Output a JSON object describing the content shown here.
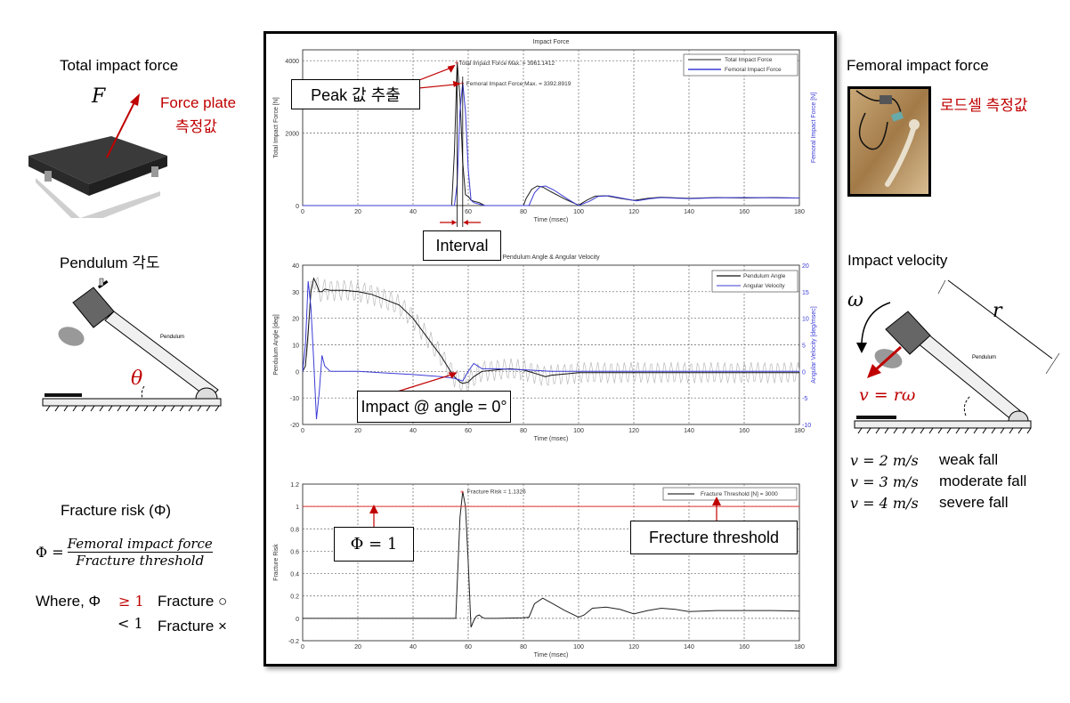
{
  "left_panel": {
    "total_impact_title": "Total impact force",
    "force_symbol": "F",
    "force_plate_label_1": "Force plate",
    "force_plate_label_2": "측정값",
    "pendulum_title": "Pendulum 각도",
    "theta_symbol": "θ",
    "pendulum_text": "Pendulum",
    "fracture_risk_title": "Fracture risk (Φ)",
    "formula_lhs": "Φ =",
    "formula_numerator": "Femoral impact force",
    "formula_denominator": "Fracture threshold",
    "where_label": "Where, Φ",
    "cond_ge": "≥ 1",
    "cond_ge_result": "Fracture ○",
    "cond_lt": "< 1",
    "cond_lt_result": "Fracture ×"
  },
  "right_panel": {
    "femoral_title": "Femoral impact force",
    "loadcell_label": "로드셀 측정값",
    "impact_velocity_title": "Impact velocity",
    "omega_symbol": "ω",
    "r_symbol": "r",
    "v_formula": "v = rω",
    "pendulum_text": "Pendulum",
    "speeds": [
      {
        "formula": "v = 2 m/s",
        "label": "weak fall"
      },
      {
        "formula": "v = 3 m/s",
        "label": "moderate fall"
      },
      {
        "formula": "v = 4 m/s",
        "label": "severe fall"
      }
    ]
  },
  "callouts": {
    "peak": "Peak 값 추출",
    "interval": "Interval",
    "impact_angle": "Impact @ angle = 0°",
    "phi_one": "Φ  = 1",
    "fracture_threshold": "Frecture threshold"
  },
  "colors": {
    "total": "#202020",
    "femoral": "#3b3bd6",
    "threshold": "#e03030",
    "annotation": "#c00000"
  },
  "chart_data": [
    {
      "type": "line",
      "title": "Impact Force",
      "xlabel": "Time (msec)",
      "ylabel": "Total Impact Force [N]",
      "ylabel_right": "Femoral Impact Force [N]",
      "xlim": [
        0,
        180
      ],
      "ylim": [
        0,
        4300
      ],
      "xticks": [
        0,
        20,
        40,
        60,
        80,
        100,
        120,
        140,
        160,
        180
      ],
      "yticks": [
        0,
        2000,
        4000
      ],
      "grid": true,
      "legend": "top-right",
      "annotations": [
        "Total Impact Force Max. = 3961.1412",
        "Femoral Impact Force Max. = 3392.8919"
      ],
      "series": [
        {
          "name": "Total Impact Force",
          "x": [
            0,
            54,
            55,
            56,
            57,
            58,
            59,
            60,
            61,
            62,
            64,
            66,
            80,
            81,
            83,
            85,
            87,
            90,
            95,
            100,
            103,
            106,
            110,
            115,
            120,
            125,
            130,
            140,
            150,
            160,
            170,
            180
          ],
          "y": [
            0,
            0,
            1500,
            3961,
            3000,
            1200,
            300,
            250,
            150,
            120,
            80,
            0,
            0,
            200,
            450,
            540,
            510,
            380,
            180,
            10,
            150,
            260,
            270,
            200,
            140,
            200,
            230,
            200,
            220,
            210,
            220,
            210
          ]
        },
        {
          "name": "Femoral Impact Force",
          "x": [
            0,
            55,
            56,
            57,
            58,
            59,
            60,
            61,
            62,
            64,
            66,
            80,
            82,
            84,
            86,
            88,
            91,
            96,
            100,
            104,
            107,
            111,
            116,
            121,
            126,
            130,
            140,
            150,
            160,
            170,
            180
          ],
          "y": [
            0,
            0,
            600,
            2600,
            3393,
            2600,
            1000,
            150,
            80,
            40,
            0,
            0,
            0,
            350,
            520,
            540,
            430,
            180,
            0,
            120,
            250,
            270,
            200,
            130,
            190,
            220,
            190,
            215,
            220,
            215,
            210
          ]
        }
      ]
    },
    {
      "type": "line",
      "title": "Pendulum Angle & Angular Velocity",
      "xlabel": "Time (msec)",
      "ylabel": "Pendulum Angle [deg]",
      "ylabel_right": "Angular Velocity [deg/msec]",
      "xlim": [
        0,
        180
      ],
      "ylim": [
        -20,
        40
      ],
      "ylim_right": [
        -10,
        20
      ],
      "xticks": [
        0,
        20,
        40,
        60,
        80,
        100,
        120,
        140,
        160,
        180
      ],
      "yticks": [
        -20,
        -10,
        0,
        10,
        20,
        30,
        40
      ],
      "yticks_right": [
        -10,
        -5,
        0,
        5,
        10,
        15,
        20
      ],
      "grid": true,
      "legend": "top-right",
      "series": [
        {
          "name": "Pendulum Angle",
          "axis": "left",
          "x": [
            0,
            1,
            2,
            3,
            4,
            5,
            6,
            7,
            8,
            10,
            15,
            20,
            25,
            30,
            35,
            40,
            45,
            50,
            53,
            55,
            57,
            58,
            60,
            62,
            65,
            70,
            75,
            80,
            85,
            88,
            90,
            95,
            100,
            110,
            120,
            140,
            160,
            180
          ],
          "y": [
            0,
            2,
            15,
            30,
            35,
            33,
            30,
            30,
            31,
            30.5,
            30.5,
            30,
            29,
            27,
            25,
            20,
            13,
            6,
            1,
            -2,
            -4,
            -4.5,
            -4,
            -2,
            0,
            0.5,
            1,
            0.5,
            -1,
            -2,
            -1.5,
            -1,
            -0.5,
            -0.5,
            -0.5,
            -0.5,
            -0.5,
            -0.5
          ]
        },
        {
          "name": "Angular Velocity",
          "axis": "right",
          "x": [
            0,
            1,
            2,
            3,
            4,
            5,
            6,
            7,
            8,
            10,
            15,
            20,
            30,
            40,
            50,
            55,
            58,
            60,
            62,
            65,
            70,
            80,
            90,
            100,
            120,
            140,
            160,
            180
          ],
          "y": [
            0,
            5,
            17,
            12,
            2,
            -9,
            -4,
            3,
            1,
            0,
            0,
            0,
            -0.3,
            -0.6,
            -1,
            -1.3,
            -1.8,
            0,
            1.5,
            0.5,
            0.5,
            0.3,
            0,
            0,
            0,
            0,
            0,
            0
          ]
        }
      ]
    },
    {
      "type": "line",
      "title": "",
      "xlabel": "Time (msec)",
      "ylabel": "Fracture Risk",
      "xlim": [
        0,
        180
      ],
      "ylim": [
        -0.2,
        1.2
      ],
      "xticks": [
        0,
        20,
        40,
        60,
        80,
        100,
        120,
        140,
        160,
        180
      ],
      "yticks": [
        -0.2,
        0,
        0.2,
        0.4,
        0.6,
        0.8,
        1,
        1.2
      ],
      "grid": true,
      "legend": "top-right",
      "legend_entry": "Fracture Threshold [N] = 3000",
      "annotations": [
        "Fracture Risk = 1.1326"
      ],
      "threshold": 1,
      "series": [
        {
          "name": "Fracture Risk",
          "x": [
            0,
            55.5,
            56,
            57,
            58,
            59,
            60,
            61,
            62,
            63,
            64,
            65,
            66,
            70,
            80,
            82,
            84,
            87,
            90,
            95,
            100,
            102,
            105,
            110,
            115,
            120,
            125,
            130,
            135,
            140,
            150,
            160,
            170,
            180
          ],
          "y": [
            0,
            0,
            0.3,
            0.9,
            1.1326,
            1.0,
            0.5,
            -0.08,
            -0.02,
            0.02,
            0.03,
            0.01,
            0,
            0,
            0.005,
            0.01,
            0.13,
            0.18,
            0.14,
            0.07,
            0.01,
            0.03,
            0.09,
            0.1,
            0.08,
            0.04,
            0.07,
            0.09,
            0.08,
            0.06,
            0.07,
            0.07,
            0.07,
            0.065
          ]
        }
      ]
    }
  ]
}
